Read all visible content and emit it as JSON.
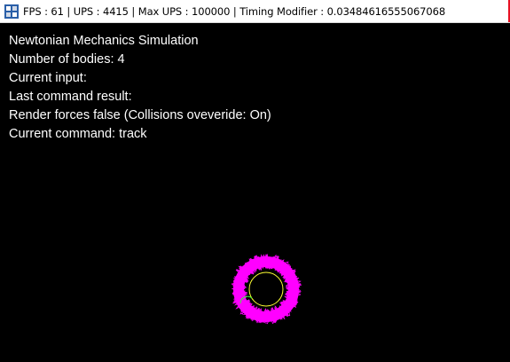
{
  "window": {
    "title": "FPS : 61 | UPS : 4415 | Max UPS : 100000 | Timing Modifier : 0.03484616555067068",
    "icon": "app-icon"
  },
  "hud": {
    "line1": "Newtonian Mechanics Simulation",
    "line2": "Number of bodies: 4",
    "line3": "Current input:",
    "line4": "Last command result:",
    "line5": "Render forces false (Collisions oveveride: On)",
    "line6": "Current command: track"
  },
  "colors": {
    "background": "#000000",
    "text": "#ffffff",
    "orbit_trail": "#ff00ff",
    "body_yellow": "#ffff33",
    "body_green": "#33ff33"
  }
}
